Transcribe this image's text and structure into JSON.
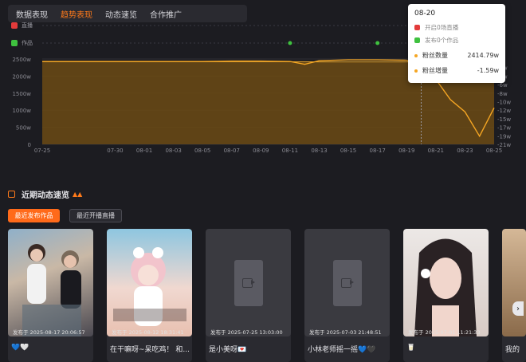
{
  "tabs": [
    "数据表现",
    "趋势表现",
    "动态速览",
    "合作推广"
  ],
  "active_tab": 1,
  "timeline_rows": {
    "live_label": "直播",
    "works_label": "作品"
  },
  "colors": {
    "accent": "#ff7a1a",
    "fans_line": "#f5a623",
    "area_fill": "#6b4a14",
    "live_icon": "#e33b3b",
    "works_icon": "#3fc13f",
    "marker": "#3fc13f"
  },
  "chart_data": {
    "type": "area",
    "x_ticks": [
      "07-25",
      "07-30",
      "08-01",
      "08-03",
      "08-05",
      "08-07",
      "08-09",
      "08-11",
      "08-13",
      "08-15",
      "08-17",
      "08-19",
      "08-21",
      "08-23",
      "08-25"
    ],
    "left_axis_ticks": [
      "0",
      "500w",
      "1000w",
      "1500w",
      "2000w",
      "2500w"
    ],
    "right_axis_ticks": [
      "0w",
      "-2w",
      "-4w",
      "-6w",
      "-8w",
      "-10w",
      "-12w",
      "-15w",
      "-17w",
      "-19w",
      "-21w"
    ],
    "ylim_left": [
      0,
      2500
    ],
    "work_markers": [
      "08-11",
      "08-17"
    ],
    "series": [
      {
        "name": "粉丝数量",
        "x": [
          "07-25",
          "07-30",
          "08-01",
          "08-03",
          "08-05",
          "08-07",
          "08-09",
          "08-11",
          "08-12",
          "08-13",
          "08-15",
          "08-17",
          "08-19",
          "08-20",
          "08-21",
          "08-22",
          "08-23",
          "08-24",
          "08-25"
        ],
        "values": [
          2420,
          2420,
          2420,
          2420,
          2420,
          2420,
          2420,
          2420,
          2420,
          2415,
          2415,
          2415,
          2415,
          2414.79,
          2414.79,
          2414.79,
          2414.79,
          2414.79,
          2414.79
        ]
      },
      {
        "name": "粉丝增量",
        "x": [
          "07-25",
          "07-30",
          "08-01",
          "08-03",
          "08-05",
          "08-07",
          "08-09",
          "08-11",
          "08-12",
          "08-13",
          "08-15",
          "08-17",
          "08-19",
          "08-20",
          "08-21",
          "08-22",
          "08-23",
          "08-24",
          "08-25"
        ],
        "values": [
          -0.6,
          -0.6,
          -0.6,
          -0.6,
          -0.6,
          -0.5,
          -0.5,
          -0.6,
          -1.3,
          -0.4,
          -0.2,
          -0.2,
          -0.3,
          -1.59,
          -5,
          -10,
          -13,
          -19,
          -12
        ]
      }
    ]
  },
  "tooltip": {
    "date": "08-20",
    "live_text": "开启0场直播",
    "works_text": "发布0个作品",
    "fans_label": "粉丝数量",
    "fans_value": "2414.79w",
    "delta_label": "粉丝增量",
    "delta_value": "-1.59w"
  },
  "section": {
    "title": "近期动态速览"
  },
  "buttons": {
    "recent_works": "最近发布作品",
    "recent_live": "最近开播直播"
  },
  "cards": [
    {
      "date": "发布于 2025-08-17 20:06:57",
      "caption": "💙🤍",
      "thumb_colors": [
        "#6d8fb0",
        "#c6b8a8",
        "#3b3b42"
      ]
    },
    {
      "date": "发布于 2025-08-12 18:31:41",
      "caption": "在干嘛呀~呆吃鸡！ 和...",
      "thumb_colors": [
        "#e8cbb8",
        "#f3d7cf",
        "#6aa9c9"
      ]
    },
    {
      "date": "发布于 2025-07-25 13:03:00",
      "caption": "是小美呀💌",
      "thumb_colors": [
        "#3a3a40",
        "#3a3a40",
        "#3a3a40"
      ]
    },
    {
      "date": "发布于 2025-07-03 21:48:51",
      "caption": "小林老师摇一摇💙🖤",
      "thumb_colors": [
        "#3a3a40",
        "#3a3a40",
        "#3a3a40"
      ]
    },
    {
      "date": "发布于 2025-07-01 11:21:33",
      "caption": "🥛",
      "thumb_colors": [
        "#e7e2df",
        "#cdb7ad",
        "#2b2426"
      ]
    },
    {
      "date": "",
      "caption": "我的",
      "thumb_colors": [
        "#c7a17a",
        "#d5b897",
        "#8a6a4a"
      ]
    }
  ]
}
